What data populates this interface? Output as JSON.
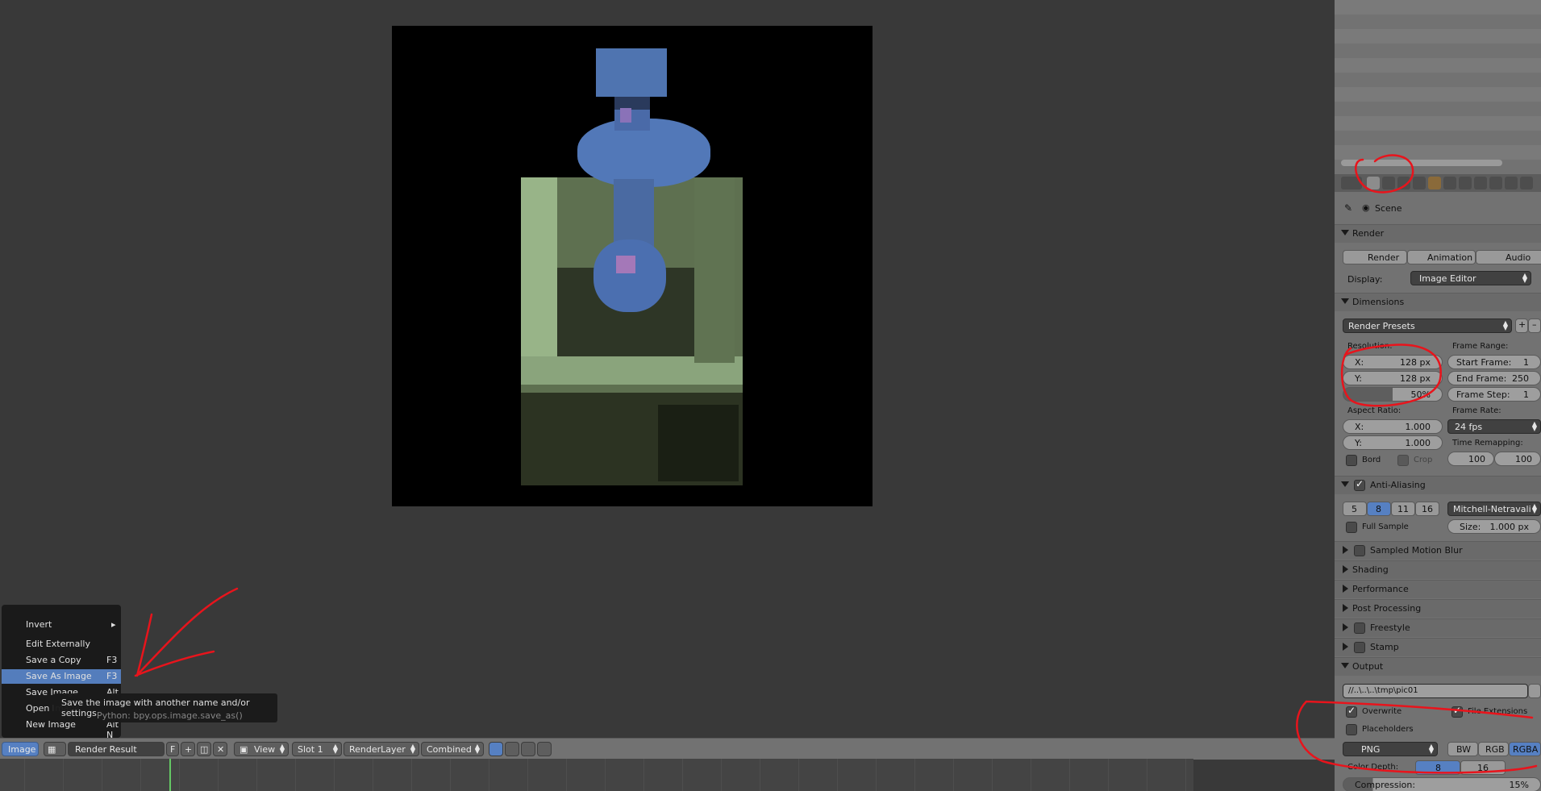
{
  "properties": {
    "scene_label": "Scene",
    "render_panel": {
      "title": "Render",
      "buttons": [
        "Render",
        "Animation",
        "Audio"
      ],
      "display_label": "Display:",
      "display_value": "Image Editor"
    },
    "dimensions_panel": {
      "title": "Dimensions",
      "presets": "Render Presets",
      "resolution_label": "Resolution:",
      "res_x": {
        "label": "X:",
        "value": "128 px"
      },
      "res_y": {
        "label": "Y:",
        "value": "128 px"
      },
      "res_percent": "50%",
      "frame_range_label": "Frame Range:",
      "start_frame": {
        "label": "Start Frame:",
        "value": "1"
      },
      "end_frame": {
        "label": "End Frame:",
        "value": "250"
      },
      "frame_step": {
        "label": "Frame Step:",
        "value": "1"
      },
      "aspect_label": "Aspect Ratio:",
      "aspect_x": {
        "label": "X:",
        "value": "1.000"
      },
      "aspect_y": {
        "label": "Y:",
        "value": "1.000"
      },
      "frame_rate_label": "Frame Rate:",
      "frame_rate": "24 fps",
      "time_remap_label": "Time Remapping:",
      "time_old": "100",
      "time_new": "100",
      "bord": "Bord",
      "crop": "Crop"
    },
    "aa_panel": {
      "title": "Anti-Aliasing",
      "samples": [
        "5",
        "8",
        "11",
        "16"
      ],
      "selected_sample": "8",
      "filter": "Mitchell-Netravali",
      "full_sample": "Full Sample",
      "size": {
        "label": "Size:",
        "value": "1.000 px"
      }
    },
    "collapsed_panels": [
      "Sampled Motion Blur",
      "Shading",
      "Performance",
      "Post Processing",
      "Freestyle",
      "Stamp"
    ],
    "output_panel": {
      "title": "Output",
      "path": "//..\\..\\..\\tmp\\pic01",
      "overwrite": "Overwrite",
      "file_extensions": "File Extensions",
      "placeholders": "Placeholders",
      "format": "PNG",
      "color_modes": [
        "BW",
        "RGB",
        "RGBA"
      ],
      "selected_color_mode": "RGBA",
      "color_depth_label": "Color Depth:",
      "color_depth_values": [
        "8",
        "16"
      ],
      "compression": {
        "label": "Compression:",
        "value": "15%"
      }
    }
  },
  "header": {
    "image_menu": "Image",
    "image_name": "Render Result",
    "fake_user": "F",
    "view_menu": "View",
    "slot": "Slot 1",
    "render_layer": "RenderLayer",
    "pass": "Combined"
  },
  "image_menu": {
    "items": [
      {
        "label": "Invert",
        "shortcut": ""
      },
      {
        "label": "Edit Externally",
        "shortcut": ""
      },
      {
        "label": "Save a Copy",
        "shortcut": "F3"
      },
      {
        "label": "Save As Image",
        "shortcut": "F3"
      },
      {
        "label": "Save Image",
        "shortcut": "Alt S"
      },
      {
        "label": "Open Image",
        "shortcut": ""
      },
      {
        "label": "New Image",
        "shortcut": "Alt N"
      }
    ],
    "active_item": "Save As Image",
    "tooltip": {
      "description": "Save the image with another name and/or settings",
      "python": "Python: bpy.ops.image.save_as()"
    }
  },
  "colors": {
    "accent": "#5680c2",
    "annotation": "#e8141c",
    "panel_bg": "#727272",
    "viewport_bg": "#393939"
  }
}
